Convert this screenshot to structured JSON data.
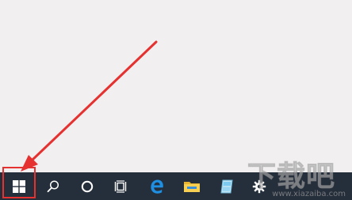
{
  "desktop": {
    "background_color": "#f1eff0"
  },
  "taskbar": {
    "background_color": "#252e3b",
    "items": [
      {
        "name": "start",
        "icon": "windows-logo-icon"
      },
      {
        "name": "search",
        "icon": "search-icon"
      },
      {
        "name": "cortana",
        "icon": "cortana-circle-icon"
      },
      {
        "name": "task-view",
        "icon": "task-view-icon"
      },
      {
        "name": "edge",
        "icon": "edge-browser-icon"
      },
      {
        "name": "file-explorer",
        "icon": "folder-icon"
      },
      {
        "name": "store",
        "icon": "store-app-icon"
      },
      {
        "name": "settings",
        "icon": "gear-icon"
      }
    ]
  },
  "annotation": {
    "color": "#e5312f",
    "arrow_target": "start-button"
  },
  "watermark": {
    "main_text": "下载吧",
    "sub_text": "www.xiazaiba.com"
  }
}
